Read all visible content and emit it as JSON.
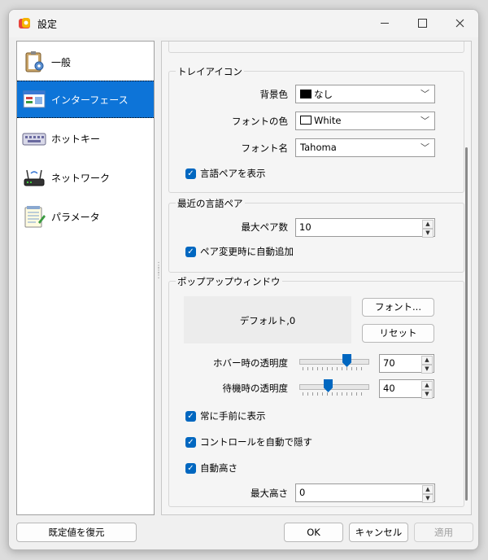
{
  "window": {
    "title": "設定"
  },
  "sidebar": {
    "items": [
      {
        "label": "一般",
        "icon": "clipboard-settings-icon"
      },
      {
        "label": "インターフェース",
        "icon": "interface-window-icon",
        "selected": true
      },
      {
        "label": "ホットキー",
        "icon": "keyboard-icon"
      },
      {
        "label": "ネットワーク",
        "icon": "router-icon"
      },
      {
        "label": "パラメータ",
        "icon": "notepad-icon"
      }
    ]
  },
  "tray": {
    "title": "トレイアイコン",
    "bg_label": "背景色",
    "bg_value": "なし",
    "bg_swatch": "#000000",
    "font_color_label": "フォントの色",
    "font_color_value": "White",
    "font_color_swatch": "#ffffff",
    "font_name_label": "フォント名",
    "font_name_value": "Tahoma",
    "show_pair_label": "言語ペアを表示",
    "show_pair_checked": true
  },
  "recent": {
    "title": "最近の言語ペア",
    "max_pairs_label": "最大ペア数",
    "max_pairs_value": "10",
    "auto_add_label": "ペア変更時に自動追加",
    "auto_add_checked": true
  },
  "popup": {
    "title": "ポップアップウィンドウ",
    "preview_text": "デフォルト,0",
    "font_button": "フォント...",
    "reset_button": "リセット",
    "hover_label": "ホバー時の透明度",
    "hover_value": "70",
    "hover_slider_fraction": 0.7,
    "idle_label": "待機時の透明度",
    "idle_value": "40",
    "idle_slider_fraction": 0.4,
    "topmost_label": "常に手前に表示",
    "topmost_checked": true,
    "autohide_label": "コントロールを自動で隠す",
    "autohide_checked": true,
    "autoheight_label": "自動高さ",
    "autoheight_checked": true,
    "max_height_label": "最大高さ",
    "max_height_value": "0"
  },
  "footer": {
    "restore_defaults": "既定値を復元",
    "ok": "OK",
    "cancel": "キャンセル",
    "apply": "適用"
  },
  "colors": {
    "accent": "#0067c0",
    "selection": "#0d74d8"
  }
}
